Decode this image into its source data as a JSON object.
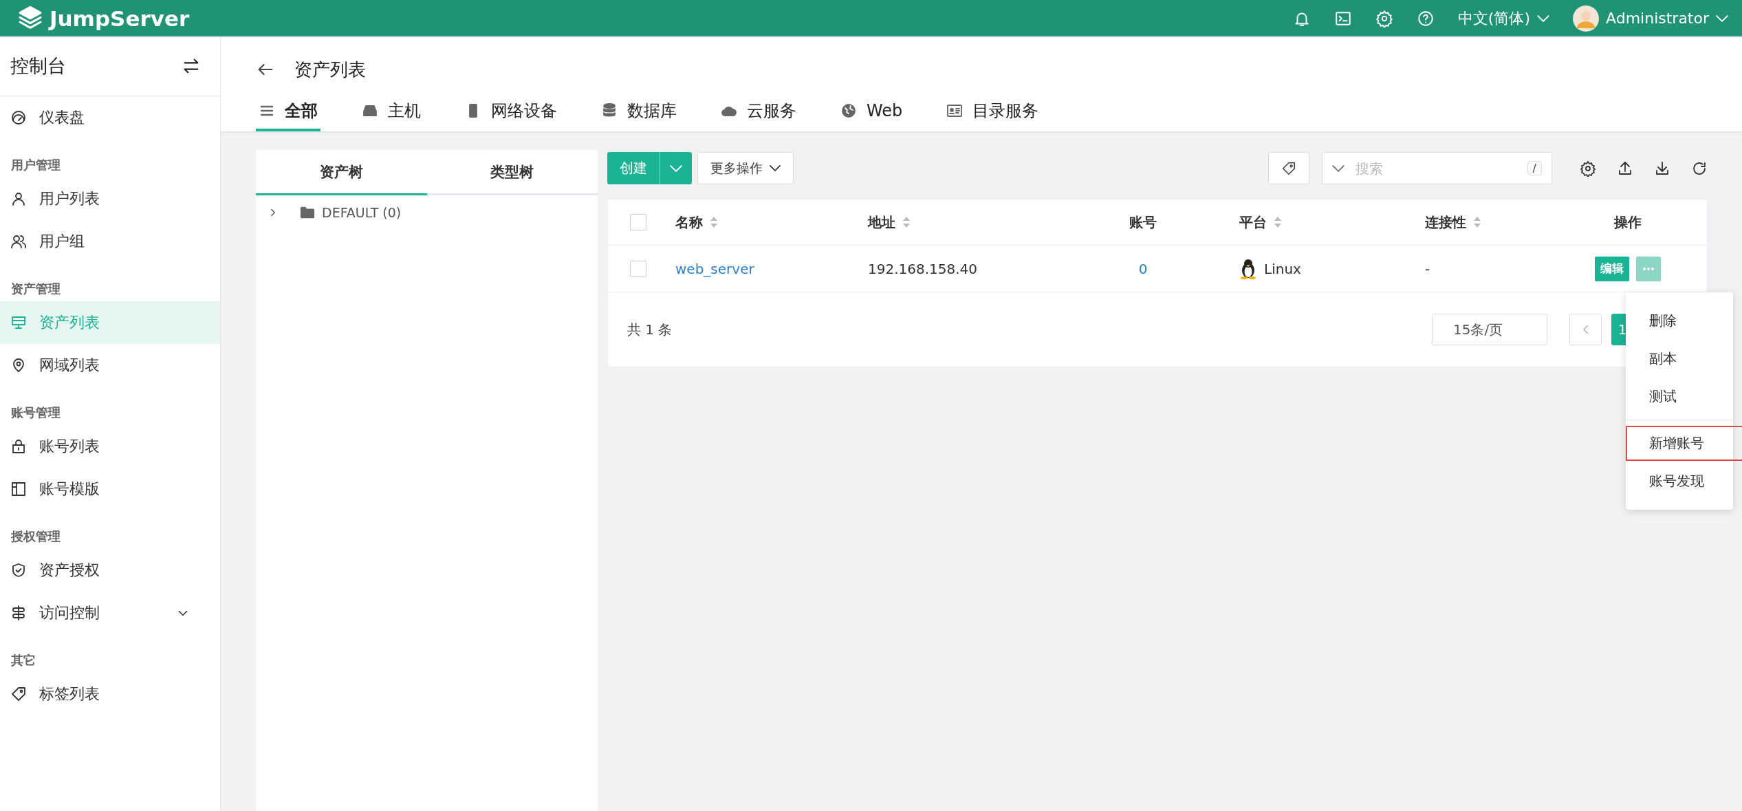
{
  "topbar": {
    "brand": "JumpServer",
    "language": "中文(简体)",
    "user": "Administrator"
  },
  "sidebar": {
    "title": "控制台",
    "items": [
      {
        "kind": "item",
        "label": "仪表盘",
        "selected": false
      },
      {
        "kind": "group",
        "label": "用户管理"
      },
      {
        "kind": "item",
        "label": "用户列表",
        "selected": false
      },
      {
        "kind": "item",
        "label": "用户组",
        "selected": false
      },
      {
        "kind": "group",
        "label": "资产管理"
      },
      {
        "kind": "item",
        "label": "资产列表",
        "selected": true
      },
      {
        "kind": "item",
        "label": "网域列表",
        "selected": false
      },
      {
        "kind": "group",
        "label": "账号管理"
      },
      {
        "kind": "item",
        "label": "账号列表",
        "selected": false
      },
      {
        "kind": "item",
        "label": "账号模版",
        "selected": false
      },
      {
        "kind": "group",
        "label": "授权管理"
      },
      {
        "kind": "item",
        "label": "资产授权",
        "selected": false
      },
      {
        "kind": "submenu",
        "label": "访问控制",
        "selected": false,
        "expanded": false
      },
      {
        "kind": "group",
        "label": "其它"
      },
      {
        "kind": "item",
        "label": "标签列表",
        "selected": false
      }
    ]
  },
  "header": {
    "title": "资产列表",
    "tabs": [
      {
        "label": "全部",
        "selected": true
      },
      {
        "label": "主机",
        "selected": false
      },
      {
        "label": "网络设备",
        "selected": false
      },
      {
        "label": "数据库",
        "selected": false
      },
      {
        "label": "云服务",
        "selected": false
      },
      {
        "label": "Web",
        "selected": false
      },
      {
        "label": "目录服务",
        "selected": false
      }
    ]
  },
  "tree": {
    "tabs": [
      {
        "label": "资产树",
        "selected": true
      },
      {
        "label": "类型树",
        "selected": false
      }
    ],
    "nodes": [
      {
        "label": "DEFAULT (0)",
        "expanded": false
      }
    ]
  },
  "toolbar": {
    "create": "创建",
    "more": "更多操作",
    "search_placeholder": "搜索",
    "search_shortcut": "/"
  },
  "table": {
    "all_checked": false,
    "columns": [
      {
        "label": "名称",
        "sortable": true
      },
      {
        "label": "地址",
        "sortable": true
      },
      {
        "label": "账号",
        "sortable": false
      },
      {
        "label": "平台",
        "sortable": true
      },
      {
        "label": "连接性",
        "sortable": true
      },
      {
        "label": "操作",
        "sortable": false
      }
    ],
    "rows": [
      {
        "checked": false,
        "name": "web_server",
        "address": "192.168.158.40",
        "accounts": "0",
        "platform": "Linux",
        "connectivity": "-",
        "edit": "编辑"
      }
    ]
  },
  "pagination": {
    "total": "共 1 条",
    "page_size": "15条/页",
    "pages": [
      {
        "label": "1",
        "selected": true
      }
    ]
  },
  "menu": {
    "items": [
      {
        "label": "删除",
        "highlighted": false,
        "divider_before": false
      },
      {
        "label": "副本",
        "highlighted": false,
        "divider_before": false
      },
      {
        "label": "测试",
        "highlighted": false,
        "divider_before": false
      },
      {
        "label": "新增账号",
        "highlighted": true,
        "divider_before": true
      },
      {
        "label": "账号发现",
        "highlighted": false,
        "divider_before": false
      }
    ]
  }
}
